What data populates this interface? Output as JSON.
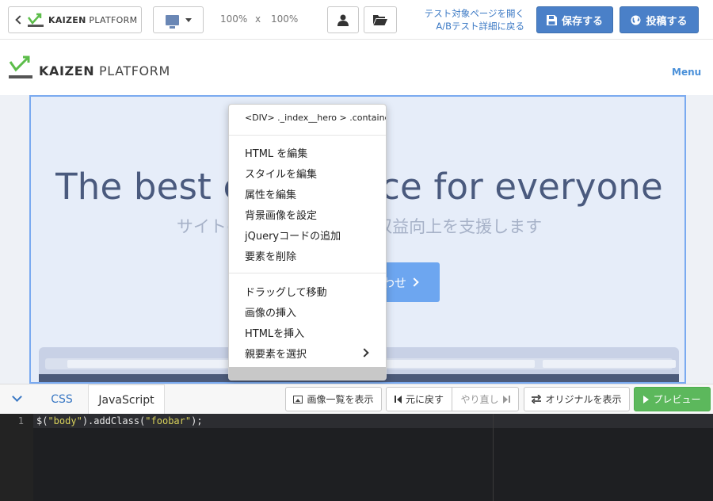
{
  "toolbar": {
    "logo_bold": "KAIZEN",
    "logo_light": " PLATFORM",
    "zoom_width": "100%",
    "zoom_sep": "x",
    "zoom_height": "100%",
    "link_open_page": "テスト対象ページを開く",
    "link_back_ab": "A/Bテスト詳細に戻る",
    "save_label": "保存する",
    "post_label": "投稿する",
    "icons": {
      "back": "chevron-left-icon",
      "device": "desktop-monitor-icon",
      "user": "user-icon",
      "folder": "folder-open-icon",
      "save": "floppy-disk-icon",
      "post": "globe-icon"
    }
  },
  "site": {
    "logo_bold": "KAIZEN",
    "logo_light": " PLATFORM",
    "menu": "Menu",
    "hero_title": "The best experience for everyone",
    "hero_subtitle": "サイトの継続的な改善で、収益向上を支援します",
    "hero_cta": "お問い合わせ"
  },
  "context_menu": {
    "path": "<DIV> ._index__hero > .container",
    "items_group1": [
      "HTML を編集",
      "スタイルを編集",
      "属性を編集",
      "背景画像を設定",
      "jQueryコードの追加",
      "要素を削除"
    ],
    "items_group2": [
      "ドラッグして移動",
      "画像の挿入",
      "HTMLを挿入",
      "親要素を選択"
    ]
  },
  "editor": {
    "tab_css": "CSS",
    "tab_js": "JavaScript",
    "active_tab": "JavaScript",
    "btn_images": "画像一覧を表示",
    "btn_undo": "元に戻す",
    "btn_redo": "やり直し",
    "btn_original": "オリジナルを表示",
    "btn_preview": "プレビュー",
    "line_number": "1",
    "code_prefix": "$(",
    "code_str1": "\"body\"",
    "code_mid": ").addClass(",
    "code_str2": "\"foobar\"",
    "code_suffix": ");"
  },
  "colors": {
    "primary": "#4a80c8",
    "preview_green": "#5cb85c",
    "selection_outline": "#7aaaf0",
    "logo_green": "#5cbd4a"
  }
}
